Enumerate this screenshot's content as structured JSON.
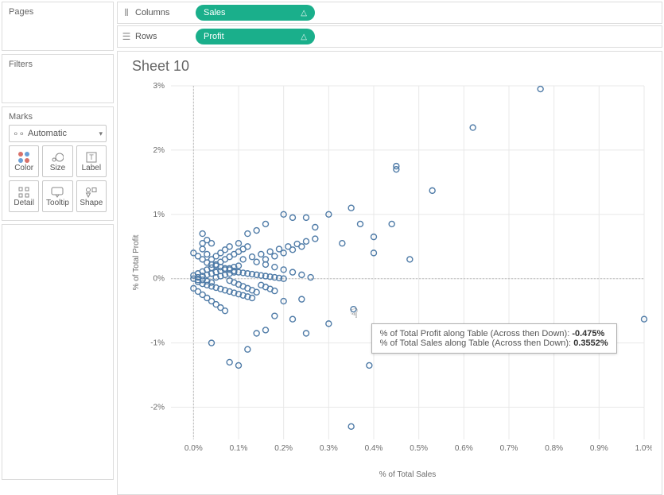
{
  "left": {
    "pages_title": "Pages",
    "filters_title": "Filters",
    "marks_title": "Marks",
    "mark_type": "Automatic",
    "cells": {
      "color": "Color",
      "size": "Size",
      "label": "Label",
      "detail": "Detail",
      "tooltip": "Tooltip",
      "shape": "Shape"
    }
  },
  "shelves": {
    "columns_label": "Columns",
    "rows_label": "Rows",
    "columns_pill": "Sales",
    "rows_pill": "Profit",
    "table_calc_symbol": "△"
  },
  "sheet": {
    "title": "Sheet 10"
  },
  "tooltip": {
    "line1_label": "% of Total Profit along Table (Across then Down):",
    "line1_value": "-0.475%",
    "line2_label": "% of Total Sales along Table (Across then Down):",
    "line2_value": "0.3552%"
  },
  "chart_data": {
    "type": "scatter",
    "xlabel": "% of Total Sales",
    "ylabel": "% of Total Profit",
    "xlim": [
      -0.05,
      1.0
    ],
    "ylim": [
      -2.5,
      3.0
    ],
    "x_ticks": [
      0.0,
      0.1,
      0.2,
      0.3,
      0.4,
      0.5,
      0.6,
      0.7,
      0.8,
      0.9,
      1.0
    ],
    "y_ticks": [
      -2,
      -1,
      0,
      1,
      2,
      3
    ],
    "x_tick_format": "0.0%",
    "y_tick_format": "0%",
    "highlight_point": {
      "x": 0.3552,
      "y": -0.475
    },
    "series": [
      {
        "name": "points",
        "points": [
          [
            0.77,
            2.95
          ],
          [
            0.62,
            2.35
          ],
          [
            0.45,
            1.75
          ],
          [
            0.45,
            1.7
          ],
          [
            0.53,
            1.37
          ],
          [
            0.35,
            1.1
          ],
          [
            0.37,
            0.85
          ],
          [
            0.44,
            0.85
          ],
          [
            0.3,
            1.0
          ],
          [
            0.25,
            0.95
          ],
          [
            0.22,
            0.95
          ],
          [
            0.2,
            1.0
          ],
          [
            0.27,
            0.8
          ],
          [
            0.4,
            0.65
          ],
          [
            0.4,
            0.4
          ],
          [
            0.33,
            0.55
          ],
          [
            0.16,
            0.85
          ],
          [
            0.14,
            0.75
          ],
          [
            0.12,
            0.7
          ],
          [
            0.1,
            0.55
          ],
          [
            0.48,
            0.3
          ],
          [
            1.0,
            -0.63
          ],
          [
            0.35,
            -2.3
          ],
          [
            0.39,
            -1.35
          ],
          [
            0.355,
            -0.475
          ],
          [
            0.3,
            -0.7
          ],
          [
            0.25,
            -0.85
          ],
          [
            0.22,
            -0.63
          ],
          [
            0.1,
            -1.35
          ],
          [
            0.08,
            -1.3
          ],
          [
            0.12,
            -1.1
          ],
          [
            0.04,
            -1.0
          ],
          [
            0.14,
            -0.85
          ],
          [
            0.16,
            -0.8
          ],
          [
            0.18,
            -0.58
          ],
          [
            0.2,
            -0.35
          ],
          [
            0.24,
            -0.32
          ],
          [
            0.02,
            0.7
          ],
          [
            0.03,
            0.6
          ],
          [
            0.04,
            0.55
          ],
          [
            0.0,
            0.4
          ],
          [
            0.01,
            0.35
          ],
          [
            0.02,
            0.3
          ],
          [
            0.03,
            0.25
          ],
          [
            0.04,
            0.22
          ],
          [
            0.05,
            0.2
          ],
          [
            0.06,
            0.18
          ],
          [
            0.07,
            0.16
          ],
          [
            0.08,
            0.14
          ],
          [
            0.09,
            0.12
          ],
          [
            0.1,
            0.1
          ],
          [
            0.11,
            0.09
          ],
          [
            0.12,
            0.08
          ],
          [
            0.13,
            0.07
          ],
          [
            0.14,
            0.06
          ],
          [
            0.15,
            0.05
          ],
          [
            0.16,
            0.04
          ],
          [
            0.17,
            0.03
          ],
          [
            0.18,
            0.02
          ],
          [
            0.19,
            0.01
          ],
          [
            0.2,
            0.0
          ],
          [
            0.0,
            0.0
          ],
          [
            0.01,
            0.02
          ],
          [
            0.02,
            0.04
          ],
          [
            0.03,
            0.06
          ],
          [
            0.04,
            0.08
          ],
          [
            0.05,
            0.1
          ],
          [
            0.06,
            0.12
          ],
          [
            0.07,
            0.14
          ],
          [
            0.08,
            0.16
          ],
          [
            0.09,
            0.18
          ],
          [
            0.1,
            0.2
          ],
          [
            0.0,
            0.05
          ],
          [
            0.01,
            0.08
          ],
          [
            0.02,
            0.11
          ],
          [
            0.03,
            0.14
          ],
          [
            0.04,
            0.17
          ],
          [
            0.05,
            0.22
          ],
          [
            0.06,
            0.26
          ],
          [
            0.07,
            0.3
          ],
          [
            0.08,
            0.34
          ],
          [
            0.09,
            0.38
          ],
          [
            0.1,
            0.42
          ],
          [
            0.11,
            0.46
          ],
          [
            0.12,
            0.5
          ],
          [
            0.01,
            -0.05
          ],
          [
            0.02,
            -0.08
          ],
          [
            0.03,
            -0.1
          ],
          [
            0.04,
            -0.12
          ],
          [
            0.05,
            -0.14
          ],
          [
            0.06,
            -0.16
          ],
          [
            0.07,
            -0.18
          ],
          [
            0.08,
            -0.2
          ],
          [
            0.09,
            -0.22
          ],
          [
            0.1,
            -0.24
          ],
          [
            0.11,
            -0.26
          ],
          [
            0.12,
            -0.28
          ],
          [
            0.13,
            -0.3
          ],
          [
            0.05,
            0.35
          ],
          [
            0.06,
            0.4
          ],
          [
            0.07,
            0.45
          ],
          [
            0.08,
            0.5
          ],
          [
            0.04,
            0.3
          ],
          [
            0.03,
            0.38
          ],
          [
            0.02,
            0.46
          ],
          [
            0.16,
            0.3
          ],
          [
            0.18,
            0.35
          ],
          [
            0.2,
            0.4
          ],
          [
            0.22,
            0.45
          ],
          [
            0.24,
            0.5
          ],
          [
            0.14,
            0.26
          ],
          [
            0.16,
            0.22
          ],
          [
            0.18,
            0.18
          ],
          [
            0.2,
            0.14
          ],
          [
            0.22,
            0.1
          ],
          [
            0.24,
            0.06
          ],
          [
            0.26,
            0.02
          ],
          [
            0.11,
            0.3
          ],
          [
            0.13,
            0.34
          ],
          [
            0.15,
            0.38
          ],
          [
            0.17,
            0.42
          ],
          [
            0.19,
            0.46
          ],
          [
            0.21,
            0.5
          ],
          [
            0.23,
            0.54
          ],
          [
            0.25,
            0.58
          ],
          [
            0.27,
            0.62
          ],
          [
            0.0,
            -0.15
          ],
          [
            0.01,
            -0.2
          ],
          [
            0.02,
            -0.25
          ],
          [
            0.03,
            -0.3
          ],
          [
            0.04,
            -0.35
          ],
          [
            0.05,
            -0.4
          ],
          [
            0.06,
            -0.45
          ],
          [
            0.07,
            -0.5
          ],
          [
            0.08,
            -0.03
          ],
          [
            0.09,
            -0.06
          ],
          [
            0.1,
            -0.09
          ],
          [
            0.11,
            -0.12
          ],
          [
            0.12,
            -0.15
          ],
          [
            0.13,
            -0.18
          ],
          [
            0.14,
            -0.21
          ],
          [
            0.05,
            0.02
          ],
          [
            0.06,
            0.04
          ],
          [
            0.07,
            0.06
          ],
          [
            0.08,
            0.08
          ],
          [
            0.09,
            0.1
          ],
          [
            0.02,
            -0.02
          ],
          [
            0.03,
            -0.04
          ],
          [
            0.04,
            -0.06
          ],
          [
            0.01,
            -0.02
          ],
          [
            0.15,
            -0.1
          ],
          [
            0.16,
            -0.13
          ],
          [
            0.17,
            -0.16
          ],
          [
            0.18,
            -0.19
          ],
          [
            0.02,
            0.55
          ]
        ]
      }
    ]
  }
}
